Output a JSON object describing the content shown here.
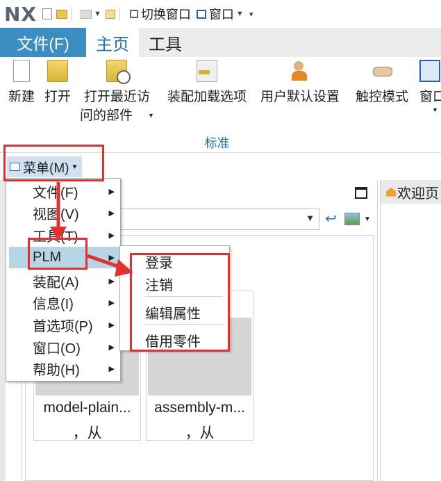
{
  "app": {
    "logo": "NX"
  },
  "quick_access": {
    "switch_window": "切换窗口",
    "window_menu": "窗口"
  },
  "tabs": [
    {
      "label": "文件(F)"
    },
    {
      "label": "主页"
    },
    {
      "label": "工具"
    }
  ],
  "ribbon": {
    "buttons": [
      {
        "label": "新建",
        "icon": "new-document-icon"
      },
      {
        "label": "打开",
        "icon": "open-folder-icon"
      },
      {
        "label": "打开最近访问的部件",
        "line1": "打开最近访",
        "line2": "问的部件",
        "icon": "recent-parts-icon"
      },
      {
        "label": "装配加载选项",
        "icon": "assembly-load-options-icon"
      },
      {
        "label": "用户默认设置",
        "icon": "user-defaults-icon"
      },
      {
        "label": "触控模式",
        "icon": "touch-mode-icon"
      },
      {
        "label": "窗口",
        "icon": "window-icon"
      }
    ],
    "group_label": "标准"
  },
  "menu_button": {
    "label": "菜单(M)"
  },
  "main_menu": {
    "items": [
      {
        "label": "文件(F)"
      },
      {
        "label": "视图(V)"
      },
      {
        "label": "工具(T)"
      },
      {
        "label": "PLM"
      },
      {
        "label": "装配(A)"
      },
      {
        "label": "信息(I)"
      },
      {
        "label": "首选项(P)"
      },
      {
        "label": "窗口(O)"
      },
      {
        "label": "帮助(H)"
      }
    ]
  },
  "plm_submenu": {
    "items": [
      {
        "label": "登录"
      },
      {
        "label": "注销"
      },
      {
        "label": "编辑属性"
      },
      {
        "label": "借用零件"
      }
    ]
  },
  "welcome_tab": {
    "label": "欢迎页"
  },
  "cards": [
    {
      "title": "model-plain...",
      "sub": "，从"
    },
    {
      "title": "assembly-m...",
      "sub": "，从"
    }
  ],
  "colors": {
    "file_tab": "#3c8ec2",
    "accent": "#1e6fb0",
    "highlight": "#b6d6e6",
    "annotation": "#e53030"
  }
}
